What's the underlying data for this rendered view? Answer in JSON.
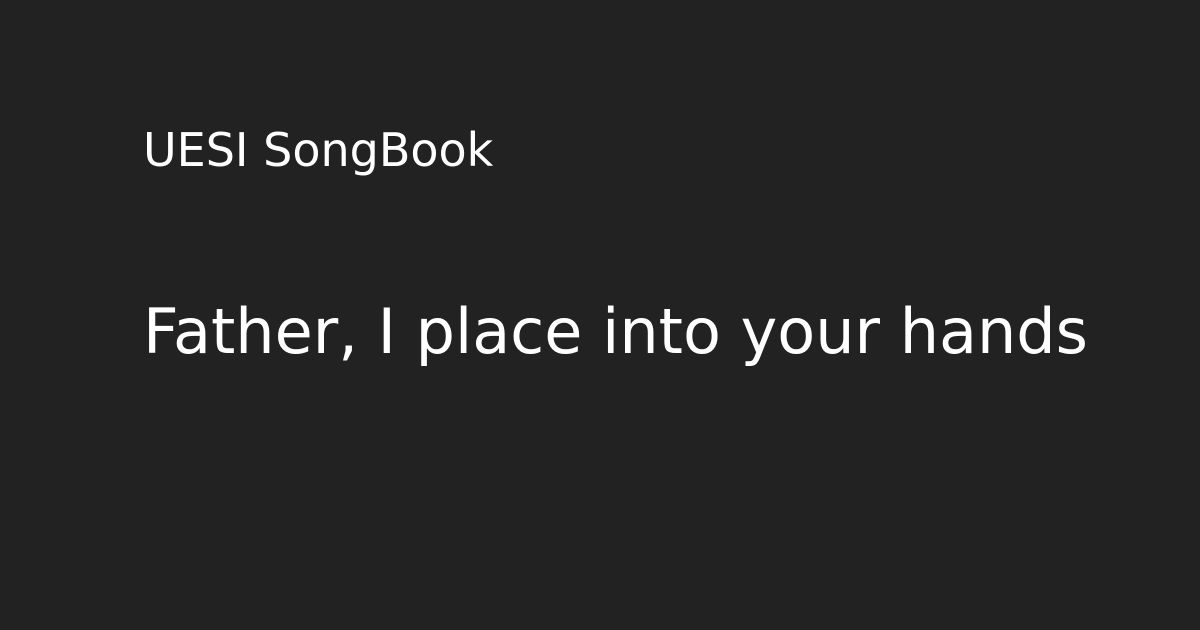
{
  "site": {
    "name": "UESI SongBook"
  },
  "song": {
    "title": "Father, I place into your hands"
  },
  "colors": {
    "background": "#222222",
    "text": "#ffffff"
  }
}
